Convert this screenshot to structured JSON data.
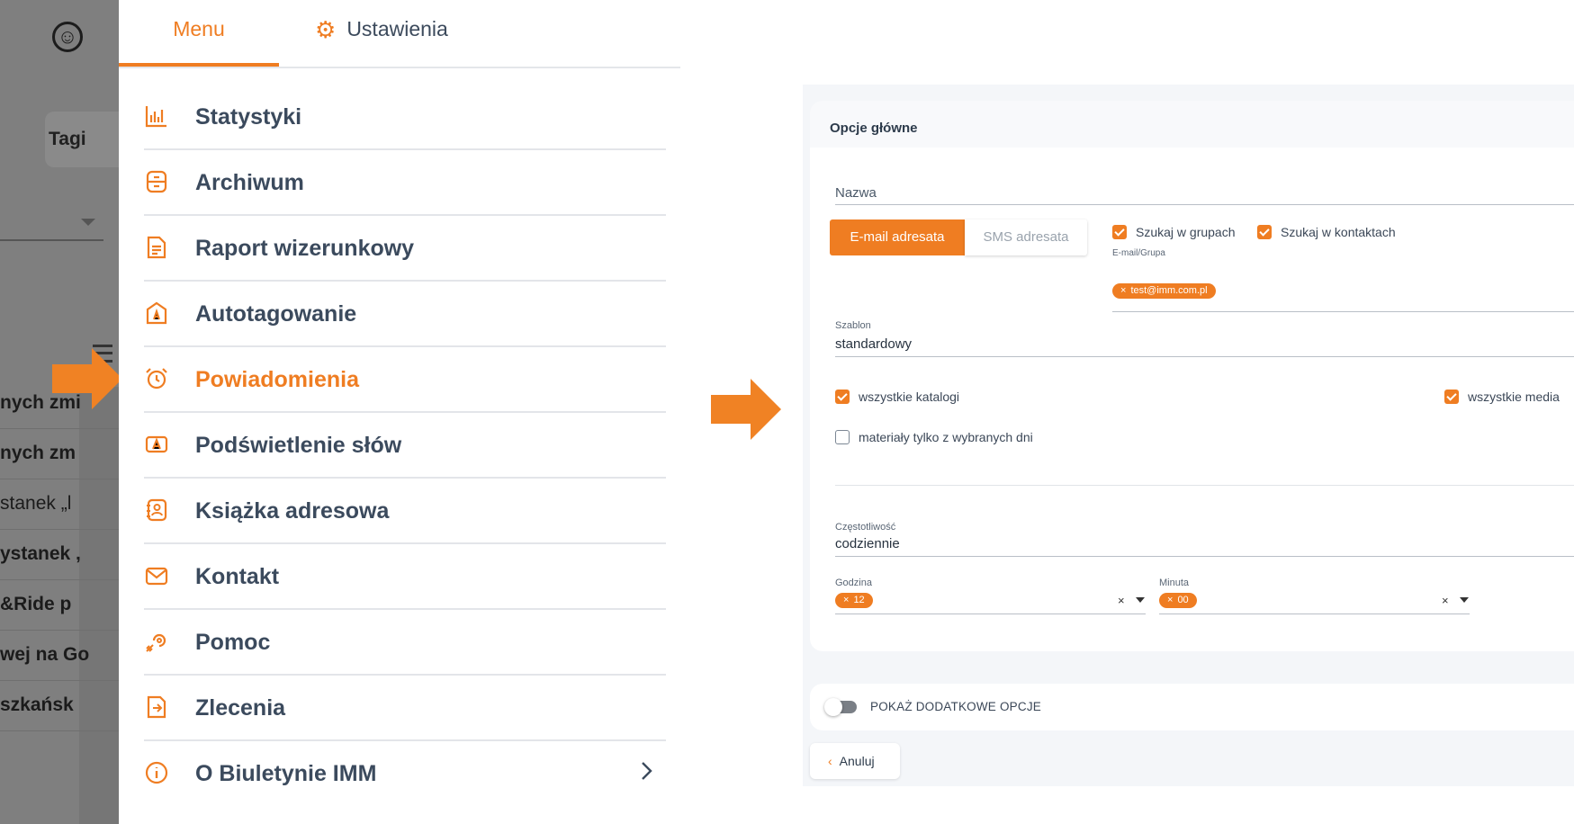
{
  "background_app": {
    "tag_button": "Tagi",
    "rows": [
      "nych zmi",
      "nych zm",
      "stanek „l",
      "ystanek ,",
      "&Ride p",
      "wej na Go",
      "szkańsk"
    ]
  },
  "menu": {
    "tabs": [
      {
        "label": "Menu",
        "active": true
      },
      {
        "label": "Ustawienia",
        "icon": "gear-icon",
        "active": false
      }
    ],
    "items": [
      {
        "label": "Statystyki",
        "icon": "bar-chart-icon"
      },
      {
        "label": "Archiwum",
        "icon": "archive-icon"
      },
      {
        "label": "Raport wizerunkowy",
        "icon": "report-icon"
      },
      {
        "label": "Autotagowanie",
        "icon": "autotag-icon"
      },
      {
        "label": "Powiadomienia",
        "icon": "alarm-clock-icon",
        "active": true
      },
      {
        "label": "Podświetlenie słów",
        "icon": "highlight-icon"
      },
      {
        "label": "Książka adresowa",
        "icon": "address-book-icon"
      },
      {
        "label": "Kontakt",
        "icon": "mail-icon"
      },
      {
        "label": "Pomoc",
        "icon": "help-icon"
      },
      {
        "label": "Zlecenia",
        "icon": "orders-icon"
      },
      {
        "label": "O Biuletynie IMM",
        "icon": "info-icon",
        "has_submenu": true
      }
    ]
  },
  "colors": {
    "accent": "#ef7d22",
    "text": "#3b4a5d"
  },
  "form": {
    "section_title": "Opcje główne",
    "name_label": "Nazwa",
    "recipient_tabs": {
      "email": "E-mail adresata",
      "sms": "SMS adresata",
      "selected": "email"
    },
    "search_groups": {
      "label": "Szukaj w grupach",
      "checked": true
    },
    "search_contacts": {
      "label": "Szukaj w kontaktach",
      "checked": true
    },
    "email_group_label": "E-mail/Grupa",
    "email_chip": "test@imm.com.pl",
    "template_label": "Szablon",
    "template_value": "standardowy",
    "all_catalogs": {
      "label": "wszystkie katalogi",
      "checked": true
    },
    "all_media": {
      "label": "wszystkie media",
      "checked": true
    },
    "selected_days": {
      "label": "materiały tylko z wybranych dni",
      "checked": false
    },
    "frequency_label": "Częstotliwość",
    "frequency_value": "codziennie",
    "hour_label": "Godzina",
    "hour_value": "12",
    "minute_label": "Minuta",
    "minute_value": "00",
    "clear_symbol": "×",
    "chip_remove": "×",
    "extra_options_label": "POKAŻ DODATKOWE OPCJE",
    "cancel_label": "Anuluj"
  }
}
